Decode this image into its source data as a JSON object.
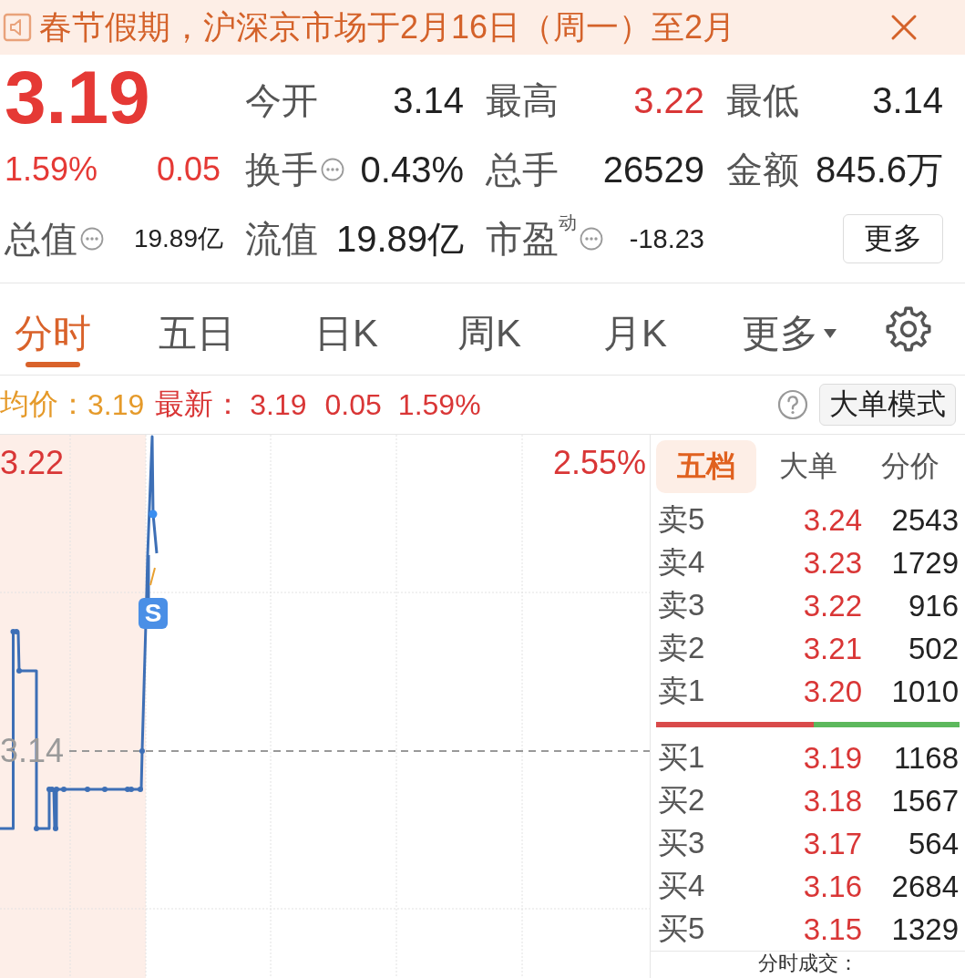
{
  "banner": {
    "text": "春节假期，沪深京市场于2月16日（周一）至2月"
  },
  "quote": {
    "price": "3.19",
    "change_percent": "1.59%",
    "change": "0.05",
    "total_value": {
      "label": "总值",
      "info": true,
      "value": "19.89亿"
    }
  },
  "stats": [
    {
      "label": "今开",
      "info": false,
      "value": "3.14",
      "color": "#222222",
      "compact": false
    },
    {
      "label": "最高",
      "info": false,
      "value": "3.22",
      "color": "#d93636",
      "compact": false
    },
    {
      "label": "最低",
      "info": false,
      "value": "3.14",
      "color": "#222222",
      "compact": false
    },
    {
      "label": "换手",
      "info": true,
      "value": "0.43%",
      "color": "#222222",
      "compact": false
    },
    {
      "label": "总手",
      "info": false,
      "value": "26529",
      "color": "#222222",
      "compact": false
    },
    {
      "label": "金额",
      "info": false,
      "value": "845.6万",
      "color": "#222222",
      "compact": false
    },
    {
      "label": "流值",
      "info": false,
      "value": "19.89亿",
      "color": "#222222",
      "compact": false
    },
    {
      "label": "市盈$^{动}$",
      "info": true,
      "value": "-18.23",
      "color": "#222222",
      "compact": true
    }
  ],
  "more_button": "更多",
  "tabs": [
    {
      "label": "分时",
      "selected": true,
      "kind": "tab"
    },
    {
      "label": "五日",
      "selected": false,
      "kind": "tab"
    },
    {
      "label": "日K",
      "selected": false,
      "kind": "tab"
    },
    {
      "label": "周K",
      "selected": false,
      "kind": "tab"
    },
    {
      "label": "月K",
      "selected": false,
      "kind": "tab"
    },
    {
      "label": "更多",
      "selected": false,
      "kind": "dropdown"
    }
  ],
  "info_bar": {
    "avg_label": "均价：",
    "avg_value": "3.19",
    "latest_label": "最新：",
    "latest_price": "3.19",
    "latest_change": "0.05",
    "latest_percent": "1.59%",
    "mode_button": "大单模式"
  },
  "chart": {
    "top_price": "3.22",
    "top_percent": "2.55%",
    "base_price": "3.14",
    "signal": "S"
  },
  "order_book": {
    "tabs": [
      {
        "label": "五档",
        "selected": true
      },
      {
        "label": "大单",
        "selected": false
      },
      {
        "label": "分价",
        "selected": false
      }
    ],
    "asks": [
      {
        "label": "卖5",
        "price": "3.24",
        "volume": "2543"
      },
      {
        "label": "卖4",
        "price": "3.23",
        "volume": "1729"
      },
      {
        "label": "卖3",
        "price": "3.22",
        "volume": "916"
      },
      {
        "label": "卖2",
        "price": "3.21",
        "volume": "502"
      },
      {
        "label": "卖1",
        "price": "3.20",
        "volume": "1010"
      }
    ],
    "ratio_bar": {
      "level": 0.52
    },
    "bids": [
      {
        "label": "买1",
        "price": "3.19",
        "volume": "1168"
      },
      {
        "label": "买2",
        "price": "3.18",
        "volume": "1567"
      },
      {
        "label": "买3",
        "price": "3.17",
        "volume": "564"
      },
      {
        "label": "买4",
        "price": "3.16",
        "volume": "2684"
      },
      {
        "label": "买5",
        "price": "3.15",
        "volume": "1329"
      }
    ],
    "footer": "分时成交："
  }
}
